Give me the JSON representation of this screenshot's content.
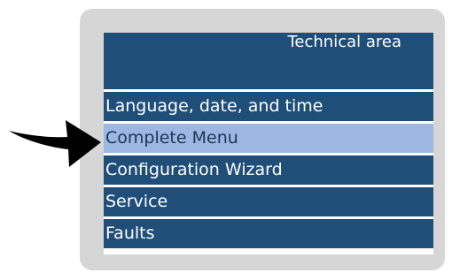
{
  "screen": {
    "title": "Technical area"
  },
  "menu": {
    "items": [
      {
        "label": "Language, date, and time",
        "selected": false
      },
      {
        "label": "Complete Menu",
        "selected": true
      },
      {
        "label": "Configuration Wizard",
        "selected": false
      },
      {
        "label": "Service",
        "selected": false
      },
      {
        "label": "Faults",
        "selected": false
      }
    ]
  },
  "icons": {
    "pointer": "arrow-right-icon"
  },
  "colors": {
    "menu_background": "#1f4e79",
    "selected_background": "#9db7e1",
    "bezel": "#d6d6d6",
    "text": "#ffffff"
  }
}
